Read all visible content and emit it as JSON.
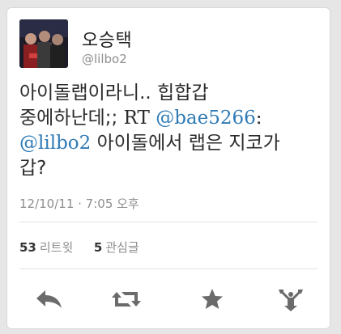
{
  "user": {
    "display_name": "오승택",
    "handle": "@lilbo2"
  },
  "tweet": {
    "line1": "아이돌랩이라니.. 힙합갑",
    "line2_text": "중에하난데;; ",
    "line2_rt": "RT",
    "line2_mention": "@bae5266",
    "line2_colon": ":",
    "line3_mention": "@lilbo2",
    "line3_text": " 아이돌에서 랩은 지코가",
    "line4": "갑?"
  },
  "timestamp": "12/10/11 · 7:05 오후",
  "stats": {
    "retweet_count": "53",
    "retweet_label": "리트윗",
    "favorite_count": "5",
    "favorite_label": "관심글"
  },
  "actions": {
    "reply_icon": "reply-icon",
    "retweet_icon": "retweet-icon",
    "favorite_icon": "star-icon",
    "share_icon": "share-icon"
  },
  "colors": {
    "mention": "#2f7bb6",
    "icon": "#6b6b6b"
  }
}
